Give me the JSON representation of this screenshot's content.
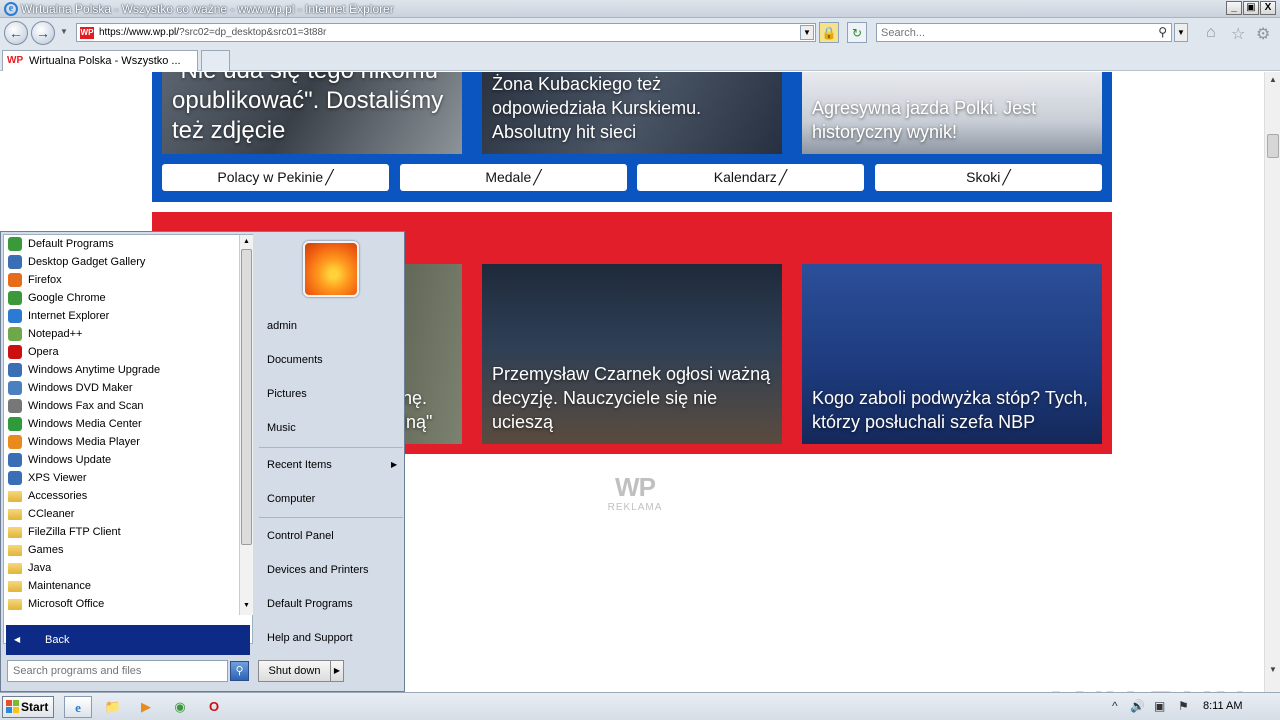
{
  "window": {
    "title": "Wirtualna Polska - Wszystko co ważne - www.wp.pl - Internet Explorer",
    "controls": {
      "minimize": "_",
      "maximize": "▣",
      "close": "X"
    }
  },
  "address_bar": {
    "url_host": "https://www.wp.pl/",
    "url_rest": "?src02=dp_desktop&src01=3t88r",
    "site_icon": "WP"
  },
  "search_bar": {
    "placeholder": "Search..."
  },
  "tabs": [
    {
      "label": "Wirtualna Polska - Wszystko ...",
      "active": true
    }
  ],
  "page": {
    "blue_cards": [
      {
        "caption": "\"Nie uda się tego nikomu opublikować\". Dostaliśmy też zdjęcie"
      },
      {
        "caption": "Żona Kubackiego też odpowiedziała Kurskiemu. Absolutny hit sieci"
      },
      {
        "caption": "Agresywna jazda Polki. Jest historyczny wynik!"
      }
    ],
    "links": [
      "Polacy w Pekinie",
      "Medale",
      "Kalendarz",
      "Skoki"
    ],
    "red_section_title": "",
    "red_cards": [
      {
        "caption": "...nę. ...lną\""
      },
      {
        "caption": "Przemysław Czarnek ogłosi ważną decyzję. Nauczyciele się nie ucieszą"
      },
      {
        "caption": "Kogo zaboli podwyżka stóp? Tych, którzy posłuchali szefa NBP"
      }
    ],
    "ad": {
      "logo": "WP",
      "label": "REKLAMA"
    },
    "watermark": "ANY RUN"
  },
  "start_menu": {
    "programs": [
      {
        "label": "Default Programs",
        "icon": "default-programs-icon",
        "color": "#3a9a3a"
      },
      {
        "label": "Desktop Gadget Gallery",
        "icon": "gadget-icon",
        "color": "#3a6fb5"
      },
      {
        "label": "Firefox",
        "icon": "firefox-icon",
        "color": "#e66b1d"
      },
      {
        "label": "Google Chrome",
        "icon": "chrome-icon",
        "color": "#3a9a3a"
      },
      {
        "label": "Internet Explorer",
        "icon": "ie-icon",
        "color": "#2b7bd4"
      },
      {
        "label": "Notepad++",
        "icon": "notepad-plus-icon",
        "color": "#6ea84a"
      },
      {
        "label": "Opera",
        "icon": "opera-icon",
        "color": "#cc1010"
      },
      {
        "label": "Windows Anytime Upgrade",
        "icon": "windows-upgrade-icon",
        "color": "#3a6fb5"
      },
      {
        "label": "Windows DVD Maker",
        "icon": "dvd-maker-icon",
        "color": "#4a7fc0"
      },
      {
        "label": "Windows Fax and Scan",
        "icon": "fax-icon",
        "color": "#777777"
      },
      {
        "label": "Windows Media Center",
        "icon": "media-center-icon",
        "color": "#2f9a3a"
      },
      {
        "label": "Windows Media Player",
        "icon": "media-player-icon",
        "color": "#e98a1c"
      },
      {
        "label": "Windows Update",
        "icon": "windows-update-icon",
        "color": "#3a6fb5"
      },
      {
        "label": "XPS Viewer",
        "icon": "xps-viewer-icon",
        "color": "#3a6fb5"
      },
      {
        "label": "Accessories",
        "icon": "folder-icon",
        "folder": true
      },
      {
        "label": "CCleaner",
        "icon": "folder-icon",
        "folder": true
      },
      {
        "label": "FileZilla FTP Client",
        "icon": "folder-icon",
        "folder": true
      },
      {
        "label": "Games",
        "icon": "folder-icon",
        "folder": true
      },
      {
        "label": "Java",
        "icon": "folder-icon",
        "folder": true
      },
      {
        "label": "Maintenance",
        "icon": "folder-icon",
        "folder": true
      },
      {
        "label": "Microsoft Office",
        "icon": "folder-icon",
        "folder": true
      }
    ],
    "back_label": "Back",
    "search_placeholder": "Search programs and files",
    "right_items": {
      "user": "admin",
      "documents": "Documents",
      "pictures": "Pictures",
      "music": "Music",
      "recent": "Recent Items",
      "computer": "Computer",
      "control_panel": "Control Panel",
      "devices": "Devices and Printers",
      "default_programs": "Default Programs",
      "help": "Help and Support"
    },
    "shutdown_label": "Shut down"
  },
  "taskbar": {
    "start_label": "Start",
    "clock": "8:11 AM"
  }
}
